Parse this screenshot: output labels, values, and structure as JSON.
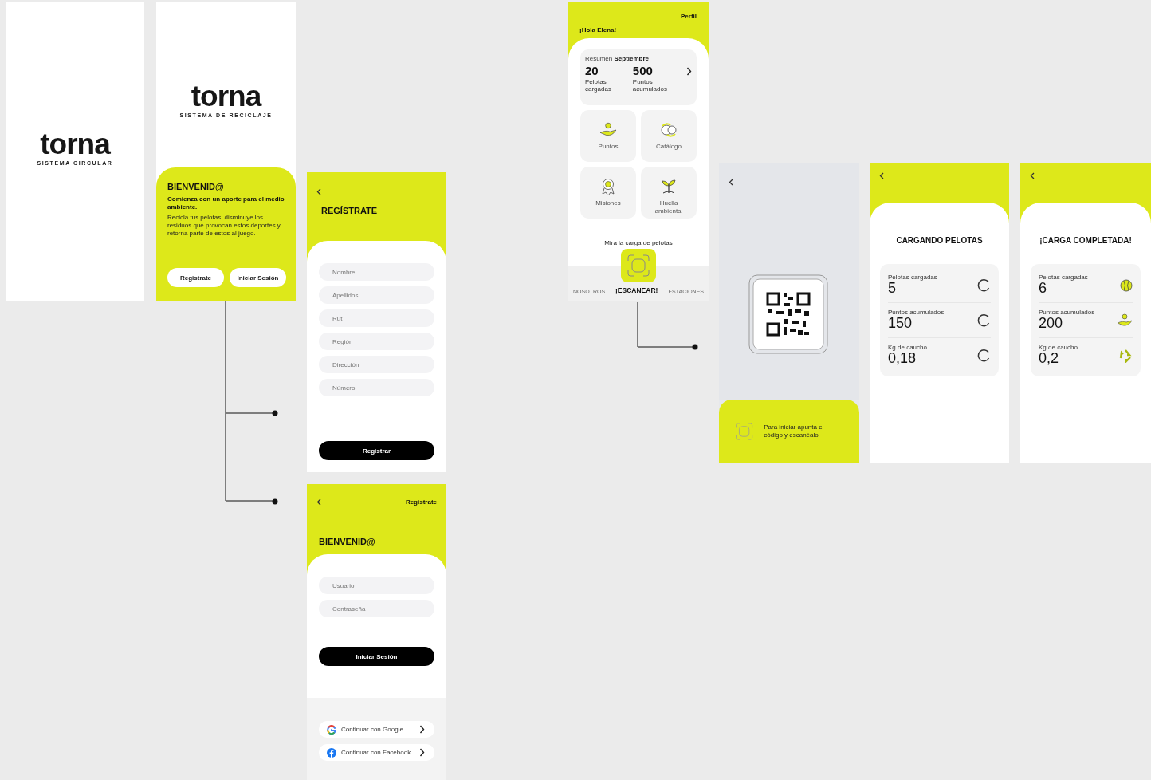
{
  "splash": {
    "logo": "torna",
    "tagline": "SISTEMA CIRCULAR"
  },
  "welcome": {
    "logo": "torna",
    "tagline": "SISTEMA DE RECICLAJE",
    "title": "BIENVENID@",
    "lead": "Comienza con un aporte para el medio ambiente.",
    "body": "Recicla tus pelotas, disminuye los residuos que provocan estos deportes y retorna parte de estos al juego.",
    "buttons": [
      "Registrate",
      "Iniciar Sesión"
    ]
  },
  "register": {
    "title": "REGÍSTRATE",
    "fields": [
      {
        "placeholder": "Nombre"
      },
      {
        "placeholder": "Apellidos"
      },
      {
        "placeholder": "Rut"
      },
      {
        "placeholder": "Región"
      },
      {
        "placeholder": "Dirección"
      },
      {
        "placeholder": "Número"
      }
    ],
    "submit": "Registrar"
  },
  "login": {
    "link": "Registrate",
    "title": "BIENVENID@",
    "fields": [
      {
        "placeholder": "Usuario"
      },
      {
        "placeholder": "Contraseña"
      }
    ],
    "submit": "Iniciar Sesión",
    "social": [
      {
        "kind": "google",
        "label": "Continuar con Google"
      },
      {
        "kind": "facebook",
        "label": "Continuar con Facebook"
      }
    ]
  },
  "home": {
    "profile": "Perfil",
    "greeting": "¡Hola Elena!",
    "summary": {
      "label": "Resumen",
      "month": "Septiembre",
      "stats": [
        {
          "value": "20",
          "label": "Pelotas cargadas"
        },
        {
          "value": "500",
          "label": "Puntos acumulados"
        }
      ]
    },
    "tiles": [
      {
        "kind": "points",
        "label": "Puntos"
      },
      {
        "kind": "catalog",
        "label": "Catálogo"
      },
      {
        "kind": "missions",
        "label": "Misiones"
      },
      {
        "kind": "footprint",
        "label": "Huella ambiental"
      }
    ],
    "scan_hint": "Mira la carga de pelotas",
    "nav": [
      {
        "label": "NOSOTROS",
        "selected": false
      },
      {
        "label": "¡ESCANEAR!",
        "selected": true
      },
      {
        "label": "ESTACIONES",
        "selected": false
      }
    ]
  },
  "scanner": {
    "hint": "Para iniciar apunta el código y escanéalo"
  },
  "loading": {
    "title": "CARGANDO PELOTAS",
    "rows": [
      {
        "label": "Pelotas cargadas",
        "value": "5",
        "kind": "spinner"
      },
      {
        "label": "Puntos acumulados",
        "value": "150",
        "kind": "spinner"
      },
      {
        "label": "Kg de caucho",
        "value": "0,18",
        "kind": "spinner"
      }
    ]
  },
  "complete": {
    "title": "¡CARGA COMPLETADA!",
    "rows": [
      {
        "label": "Pelotas cargadas",
        "value": "6",
        "kind": "ball"
      },
      {
        "label": "Puntos acumulados",
        "value": "200",
        "kind": "hand"
      },
      {
        "label": "Kg de caucho",
        "value": "0,2",
        "kind": "recycle"
      }
    ]
  }
}
